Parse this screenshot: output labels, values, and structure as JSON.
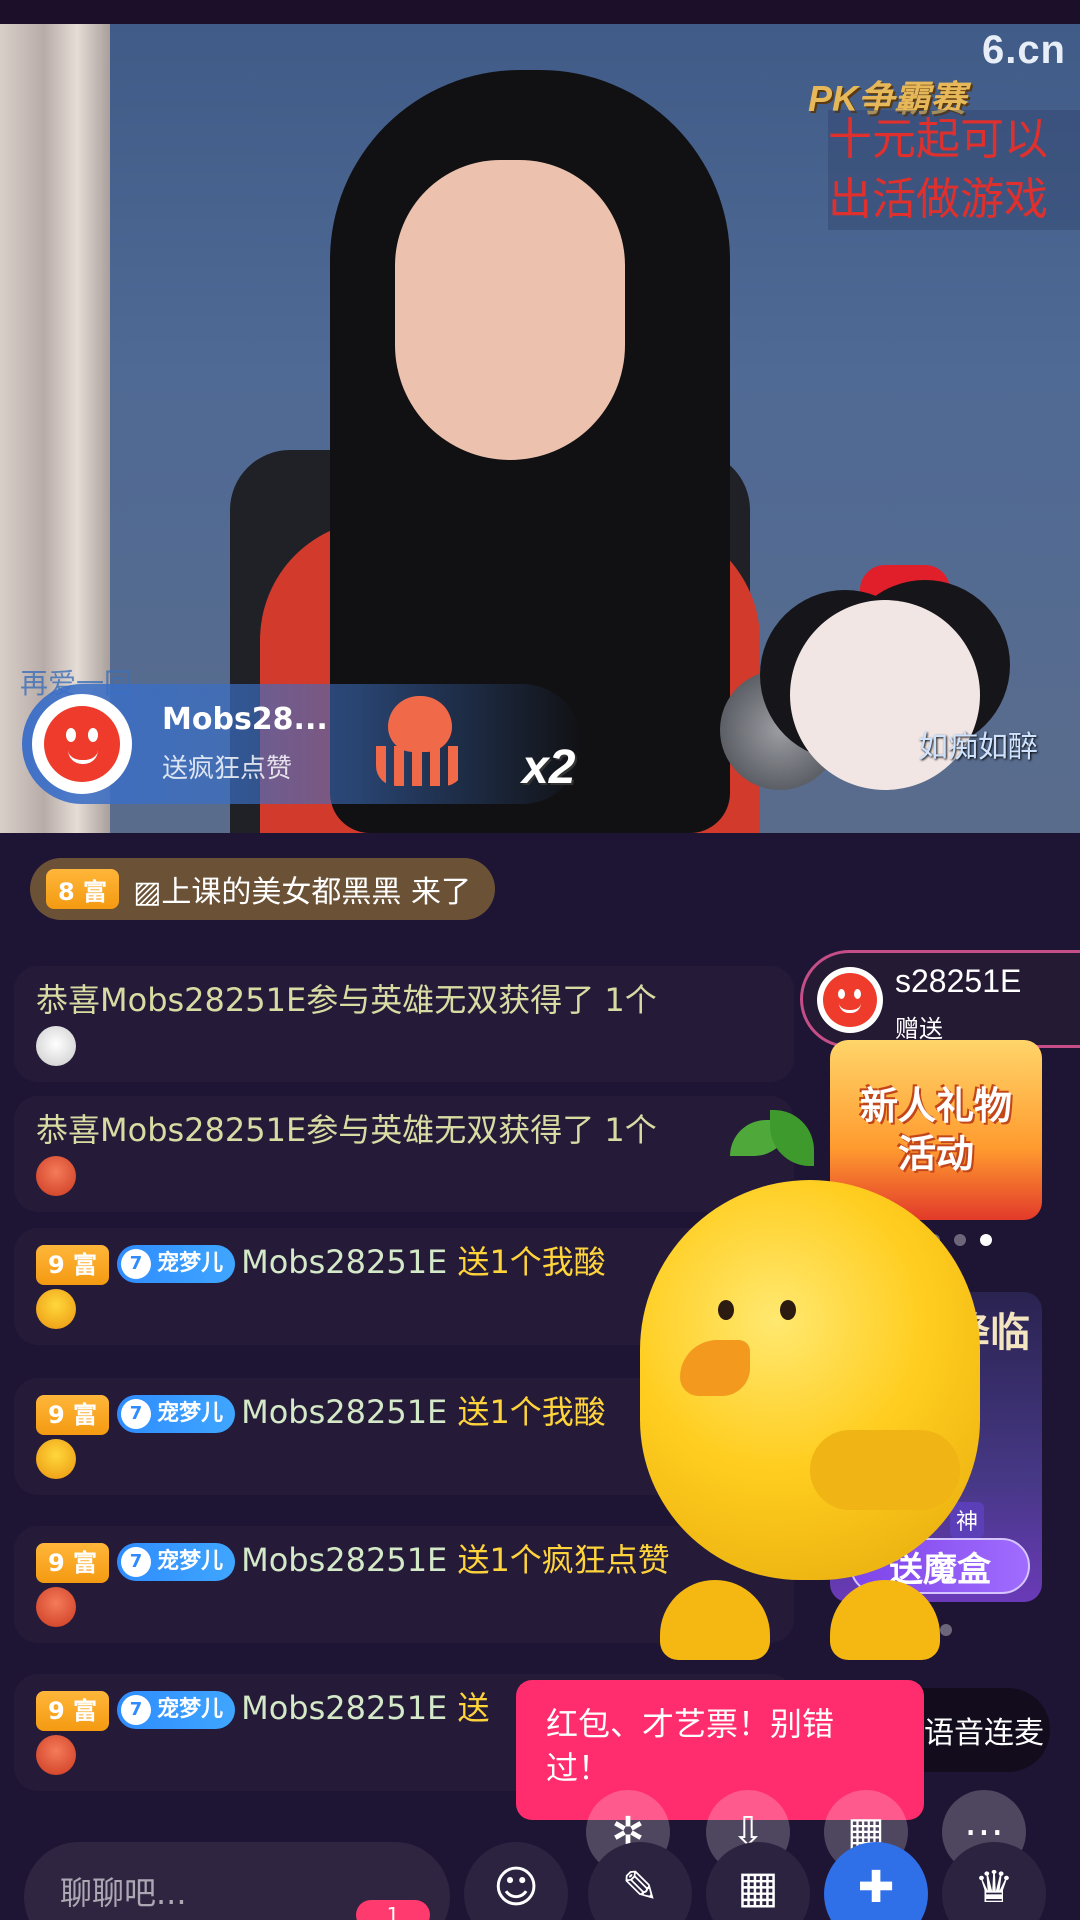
{
  "video": {
    "brand_logo": "6.cn",
    "pk_logo": "PK争霸赛",
    "promo_lines": [
      "十元起可以",
      "出活做游戏"
    ],
    "overlay_name": "如痴如醉",
    "overlay_name2": "再爱一回"
  },
  "gift_toast": {
    "user": "Mobs28...",
    "action": "送疯狂点赞",
    "multiplier": "x2"
  },
  "entry": {
    "level": "8 富",
    "text": "▨上课的美女都黑黑 来了"
  },
  "chat": [
    {
      "type": "system",
      "text": "恭喜Mobs28251E参与英雄无双获得了 1个",
      "gift_icon": "rooster-icon"
    },
    {
      "type": "system",
      "text": "恭喜Mobs28251E参与英雄无双获得了 1个",
      "gift_icon": "octopus-icon"
    },
    {
      "type": "gift",
      "level": "9 富",
      "pet_badge": "宠梦儿",
      "pet_level": "7",
      "user": "Mobs28251E",
      "gift": " 送1个我酸",
      "gift_icon": "chick-icon"
    },
    {
      "type": "gift",
      "level": "9 富",
      "pet_badge": "宠梦儿",
      "pet_level": "7",
      "user": "Mobs28251E",
      "gift": " 送1个我酸",
      "gift_icon": "chick-icon"
    },
    {
      "type": "gift",
      "level": "9 富",
      "pet_badge": "宠梦儿",
      "pet_level": "7",
      "user": "Mobs28251E",
      "gift": " 送1个疯狂点赞",
      "gift_icon": "octopus-icon"
    },
    {
      "type": "gift",
      "level": "9 富",
      "pet_badge": "宠梦儿",
      "pet_level": "7",
      "user": "Mobs28251E",
      "gift": " 送",
      "gift_icon": "octopus-icon"
    }
  ],
  "gift_notify": {
    "user": "s28251E",
    "action": "赠送"
  },
  "activity_banner": {
    "title": "新人礼物\n活动"
  },
  "activity_banner2": {
    "top_text": "降临",
    "tag": "神",
    "button": "送魔盒"
  },
  "tooltip": {
    "text": "红包、才艺票！别错过！"
  },
  "voice_pill": {
    "label": "语音连麦"
  },
  "fabs": [
    "fireworks-icon",
    "download-icon",
    "grid-icon",
    "more-icon"
  ],
  "bottom": {
    "chat_placeholder": "聊聊吧...",
    "badge_count": "1",
    "buttons": [
      "fans-icon",
      "message-icon",
      "apps-icon",
      "game-icon",
      "crown-icon",
      "gift-icon"
    ]
  },
  "colors": {
    "background": "#1e1433",
    "accent_pink": "#ff2c6e",
    "gold": "#ffd43b",
    "badge_orange": "#f49a12",
    "badge_blue": "#2f8cff"
  }
}
